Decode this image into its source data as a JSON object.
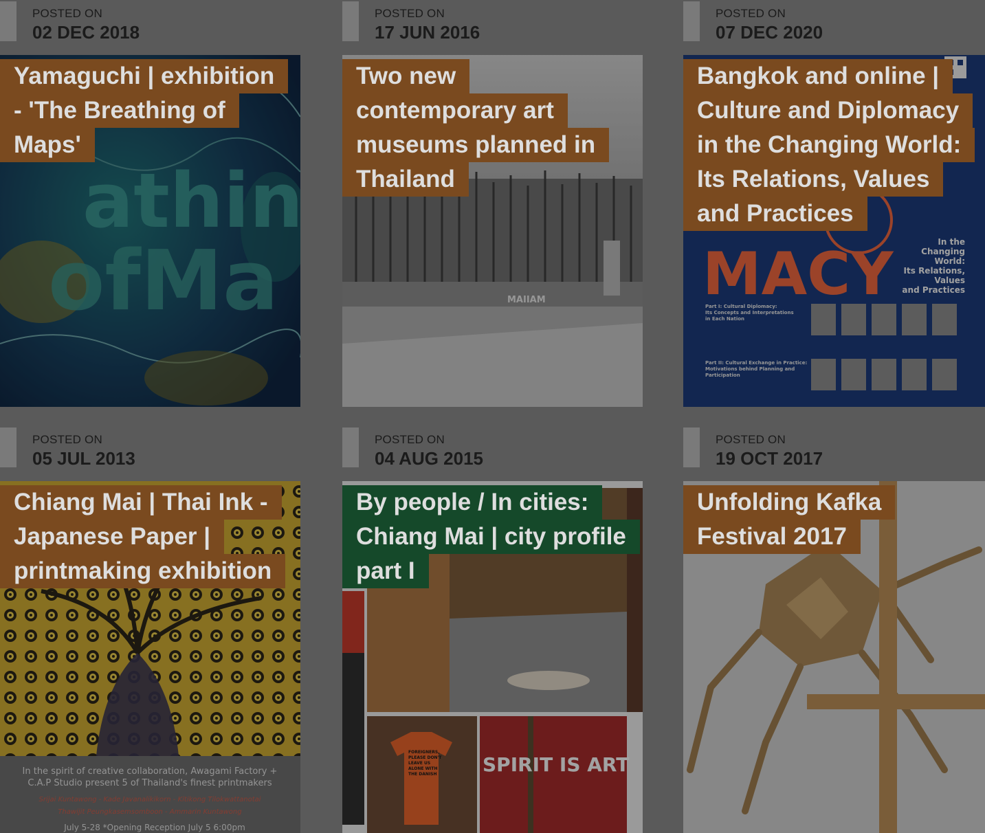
{
  "posted_label": "POSTED ON",
  "colors": {
    "title_brown": "#7a4a1f",
    "title_green": "#15492a",
    "meta_bar": "#7a7a7a",
    "background": "#5a5a5a"
  },
  "cards": [
    {
      "date": "02 DEC 2018",
      "title_lines": [
        "Yamaguchi | exhibition",
        "- 'The Breathing of",
        "Maps'"
      ],
      "title_color": "brown",
      "image": "breathing-of-maps-artwork"
    },
    {
      "date": "17 JUN 2016",
      "title_lines": [
        "Two new",
        "contemporary art",
        "museums planned in",
        "Thailand"
      ],
      "title_color": "brown",
      "image": "museum-building-photo",
      "image_text": "MAIIAM"
    },
    {
      "date": "07 DEC 2020",
      "title_lines": [
        "Bangkok and online |",
        "Culture and Diplomacy",
        "in the Changing World:",
        "Its Relations, Values",
        "and Practices"
      ],
      "title_color": "brown",
      "image": "diplomacy-poster",
      "image_text": {
        "headline": "MACY",
        "side": [
          "In the",
          "Changing",
          "World:",
          "Its Relations,",
          "Values",
          "and Practices"
        ],
        "part1": [
          "Part I: Cultural Diplomacy:",
          "Its Concepts and Interpretations",
          "in Each Nation"
        ],
        "part2": [
          "Part II: Cultural Exchange in Practice:",
          "Motivations behind Planning and",
          "Participation"
        ]
      }
    },
    {
      "date": "05 JUL 2013",
      "title_lines": [
        "Chiang Mai | Thai Ink -",
        "Japanese Paper |",
        "printmaking exhibition"
      ],
      "title_color": "brown",
      "image": "thai-ink-poster",
      "image_text": {
        "line1": "In the spirit of creative collaboration, Awagami Factory +",
        "line2": "C.A.P Studio present 5 of Thailand's finest printmakers",
        "names1": "Srijai Kuntawong - Kade Javanalikikorn - Kitikong Tilokwattanotai",
        "names2": "Thawijit Peungkasemsomboon - Ammarin Kuntawong",
        "dates": "July 5-28   *Opening Reception July 5  6:00pm"
      }
    },
    {
      "date": "04 AUG 2015",
      "title_lines": [
        "By people / In cities:",
        "Chiang Mai | city profile",
        "part I"
      ],
      "title_color": "green",
      "image": "chiang-mai-collage",
      "image_text": {
        "sign": "SPIRIT IS ART",
        "shirt": [
          "FOREIGNERS,",
          "PLEASE DON'T",
          "LEAVE US",
          "ALONE WITH",
          "THE DANISH"
        ]
      }
    },
    {
      "date": "19 OCT 2017",
      "title_lines": [
        "Unfolding Kafka",
        "Festival 2017"
      ],
      "title_color": "brown",
      "image": "origami-insect-photo"
    }
  ]
}
